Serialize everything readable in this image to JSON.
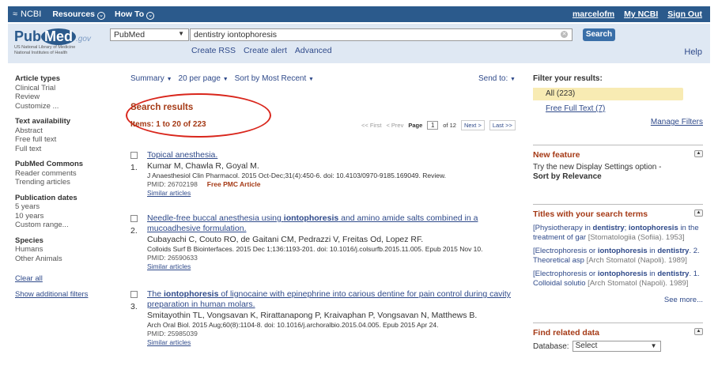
{
  "topbar": {
    "ncbi": "NCBI",
    "resources": "Resources",
    "howto": "How To",
    "user": "marcelofm",
    "myncbi": "My NCBI",
    "signout": "Sign Out"
  },
  "logo": {
    "pub": "Pub",
    "med": "Med",
    "gov": ".gov",
    "line1": "US National Library of Medicine",
    "line2": "National Institutes of Health"
  },
  "search": {
    "database": "PubMed",
    "query": "dentistry iontophoresis",
    "button": "Search",
    "create_rss": "Create RSS",
    "create_alert": "Create alert",
    "advanced": "Advanced",
    "help": "Help"
  },
  "leftnav": {
    "article_types": {
      "heading": "Article types",
      "items": [
        "Clinical Trial",
        "Review",
        "Customize ..."
      ]
    },
    "text_availability": {
      "heading": "Text availability",
      "items": [
        "Abstract",
        "Free full text",
        "Full text"
      ]
    },
    "pubmed_commons": {
      "heading": "PubMed Commons",
      "items": [
        "Reader comments",
        "Trending articles"
      ]
    },
    "publication_dates": {
      "heading": "Publication dates",
      "items": [
        "5 years",
        "10 years",
        "Custom range..."
      ]
    },
    "species": {
      "heading": "Species",
      "items": [
        "Humans",
        "Other Animals"
      ]
    },
    "clear_all": "Clear all",
    "show_filters": "Show additional filters"
  },
  "toolbar": {
    "summary": "Summary",
    "per_page": "20 per page",
    "sort": "Sort by Most Recent",
    "send_to": "Send to:"
  },
  "results_header": {
    "title": "Search results",
    "items": "Items: 1 to 20 of 223"
  },
  "pager": {
    "first": "<< First",
    "prev": "< Prev",
    "page_label": "Page",
    "page": "1",
    "of": "of 12",
    "next": "Next >",
    "last": "Last >>"
  },
  "results": [
    {
      "num": "1.",
      "title_parts": [
        "Topical anesthesia.",
        "",
        ""
      ],
      "authors": "Kumar M, Chawla R, Goyal M.",
      "citation": "J Anaesthesiol Clin Pharmacol. 2015 Oct-Dec;31(4):450-6. doi: 10.4103/0970-9185.169049. Review.",
      "pmid": "PMID: 26702198",
      "free": "Free PMC Article",
      "similar": "Similar articles"
    },
    {
      "num": "2.",
      "title_parts": [
        "Needle-free buccal anesthesia using ",
        "iontophoresis",
        " and amino amide salts combined in a mucoadhesive formulation."
      ],
      "authors": "Cubayachi C, Couto RO, de Gaitani CM, Pedrazzi V, Freitas Od, Lopez RF.",
      "citation": "Colloids Surf B Biointerfaces. 2015 Dec 1;136:1193-201. doi: 10.1016/j.colsurfb.2015.11.005. Epub 2015 Nov 10.",
      "pmid": "PMID: 26590633",
      "free": "",
      "similar": "Similar articles"
    },
    {
      "num": "3.",
      "title_parts": [
        "The ",
        "iontophoresis",
        " of lignocaine with epinephrine into carious dentine for pain control during cavity preparation in human molars."
      ],
      "authors": "Smitayothin TL, Vongsavan K, Rirattanapong P, Kraivaphan P, Vongsavan N, Matthews B.",
      "citation": "Arch Oral Biol. 2015 Aug;60(8):1104-8. doi: 10.1016/j.archoralbio.2015.04.005. Epub 2015 Apr 24.",
      "pmid": "PMID: 25985039",
      "free": "",
      "similar": "Similar articles"
    }
  ],
  "filter": {
    "heading": "Filter your results:",
    "all": "All (223)",
    "free_full_text": "Free Full Text (7)",
    "manage": "Manage Filters"
  },
  "new_feature": {
    "heading": "New feature",
    "text": "Try the new Display Settings option -",
    "bold": "Sort by Relevance"
  },
  "titles_with_terms": {
    "heading": "Titles with your search terms",
    "items": [
      {
        "pre": "[Physiotherapy in ",
        "b1": "dentistry",
        "mid": "; ",
        "b2": "iontophoresis",
        "post": " in the treatment of gar",
        "src": " [Stomatologiia (Sofiia). 1953]"
      },
      {
        "pre": "[Electrophoresis or ",
        "b1": "iontophoresis",
        "mid": " in ",
        "b2": "dentistry",
        "post": ". 2. Theoretical asp",
        "src": " [Arch Stomatol (Napoli). 1989]"
      },
      {
        "pre": "[Electrophoresis or ",
        "b1": "iontophoresis",
        "mid": " in ",
        "b2": "dentistry",
        "post": ". 1. Colloidal solutio",
        "src": " [Arch Stomatol (Napoli). 1989]"
      }
    ],
    "see_more": "See more..."
  },
  "related_data": {
    "heading": "Find related data",
    "db_label": "Database:",
    "db_value": "Select"
  }
}
